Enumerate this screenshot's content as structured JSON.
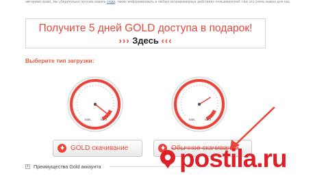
{
  "top_note": {
    "text_before": "авторами прав), мы убедительно просим нажать",
    "link": "сюда",
    "text_after": ", также информировать в любых неправомерных действиях пользователей. Нас это очень важно для нас."
  },
  "promo": {
    "title": "Получите 5 дней GOLD доступа в подарок!",
    "here_left": "›››",
    "here": "Здесь",
    "here_right": "‹‹‹"
  },
  "section_label": "Выберите тип загрузки:",
  "gauges": [
    {
      "min_label": "MIN",
      "max_label": "MAX",
      "level": 0.92
    },
    {
      "min_label": "MIN",
      "max_label": "MAX",
      "level": 0.7
    }
  ],
  "buttons": {
    "gold": "GOLD скачивание",
    "regular": "Обычное скачивание"
  },
  "advantages": "Преимущества Gold аккаунта",
  "watermark": "postila.ru",
  "colors": {
    "accent": "#e34a3c",
    "watermark": "#dc2027"
  },
  "icons": [
    "download-icon",
    "plus-icon",
    "pin-icon"
  ]
}
